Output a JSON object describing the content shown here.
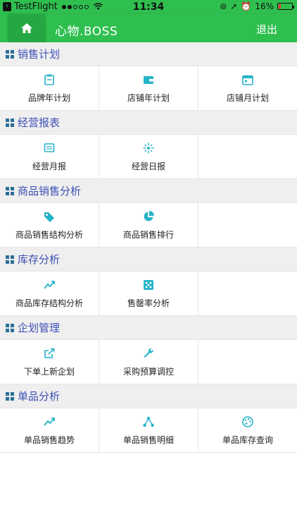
{
  "status_bar": {
    "carrier": "TestFlight",
    "time": "11:34",
    "battery": "16%",
    "battery_level": 0.16
  },
  "nav": {
    "title": "心物.BOSS",
    "logout_label": "退出"
  },
  "colors": {
    "brand_green": "#2fbf4f",
    "section_title": "#3f51b5",
    "icon_teal": "#26b3c9"
  },
  "sections": [
    {
      "title": "销售计划",
      "items": [
        {
          "label": "品牌年计划",
          "icon": "clipboard-icon"
        },
        {
          "label": "店铺年计划",
          "icon": "wallet-icon"
        },
        {
          "label": "店铺月计划",
          "icon": "calendar-icon"
        }
      ]
    },
    {
      "title": "经营报表",
      "items": [
        {
          "label": "经营月报",
          "icon": "monitor-icon"
        },
        {
          "label": "经营日报",
          "icon": "sparkle-icon"
        }
      ]
    },
    {
      "title": "商品销售分析",
      "items": [
        {
          "label": "商品销售结构分析",
          "icon": "tag-icon"
        },
        {
          "label": "商品销售排行",
          "icon": "pie-chart-icon"
        }
      ]
    },
    {
      "title": "库存分析",
      "items": [
        {
          "label": "商品库存结构分析",
          "icon": "trend-line-icon"
        },
        {
          "label": "售罄率分析",
          "icon": "dice-icon"
        }
      ]
    },
    {
      "title": "企划管理",
      "items": [
        {
          "label": "下单上新企划",
          "icon": "external-link-icon"
        },
        {
          "label": "采购预算调控",
          "icon": "wrench-icon"
        }
      ]
    },
    {
      "title": "单品分析",
      "items": [
        {
          "label": "单品销售趋势",
          "icon": "trend-line-icon"
        },
        {
          "label": "单品销售明细",
          "icon": "hierarchy-icon"
        },
        {
          "label": "单品库存查询",
          "icon": "palette-icon"
        }
      ]
    }
  ]
}
